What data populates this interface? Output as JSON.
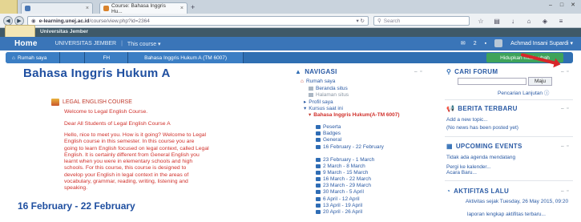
{
  "browser": {
    "tabs": [
      {
        "label": ""
      },
      {
        "label": "Course: Bahasa Inggris Hu..."
      }
    ],
    "new_tab": "+",
    "url_host": "e-learning.unej.ac.id",
    "url_path": "/course/view.php?id=2364",
    "search_placeholder": "Search"
  },
  "site": {
    "name": "Universitas Jember",
    "menu": {
      "home": "Home",
      "items": [
        "UNIVERSITAS JEMBER",
        "This course ▾"
      ],
      "user": "Achmad Insani Supardi ▾",
      "count": "2"
    }
  },
  "breadcrumb": [
    "Rumah saya",
    "",
    "FH",
    "Bahasa Inggris Hukum A (TM 6007)"
  ],
  "edit_button": "Hidupkan mode ubah",
  "course": {
    "title": "Bahasa Inggris Hukum A",
    "section_label": "LEGAL ENGLISH COURSE",
    "welcome": "Welcome to Legal English Course.",
    "greeting": "Dear All Students of Legal English Course A",
    "body": [
      "Hello, nice to meet you. How is it going? Welcome to Legal",
      "English course in this semester. In this course you are",
      "going to learn English focused on legal context, called Legal",
      "English. It is certainly different from General English you",
      "learnt when you were in elementary schools and high",
      "schools. For this course, this course is designed to",
      "develop your English in legal context in the areas of",
      "vocabulary, grammar, reading, writing, listening and",
      "speaking."
    ],
    "week_title": "16 February - 22 February"
  },
  "navigation": {
    "title": "NAVIGASI",
    "controls": "– ▫",
    "home": "Rumah saya",
    "items": [
      "Beranda situs",
      "Halaman situs",
      "Profil saya",
      "Kursus saat ini"
    ],
    "current_course": "Bahasa Inggris Hukum(A-TM 6007)",
    "sub": [
      "Peserta",
      "Badges",
      "General",
      "16 February - 22 February",
      "23 February - 1 March",
      "2 March - 8 March",
      "9 March - 15 March",
      "16 March - 22 March",
      "23 March - 29 March",
      "30 March - 5 April",
      "6 April - 12 April",
      "13 April - 19 April",
      "20 April - 26 April"
    ]
  },
  "forum_search": {
    "title": "CARI FORUM",
    "controls": "– ▫",
    "button": "Maju",
    "advanced": "Pencarian Lanjutan"
  },
  "news": {
    "title": "BERITA TERBARU",
    "add": "Add a new topic...",
    "empty": "(No news has been posted yet)"
  },
  "events": {
    "title": "UPCOMING EVENTS",
    "empty": "Tidak ada agenda mendatang",
    "goto": "Pergi ke kalender...",
    "new": "Acara Baru..."
  },
  "activity": {
    "title": "AKTIFITAS LALU",
    "since": "Aktivitas sejak Tuesday, 26 May 2015, 09:20",
    "full": "laporan lengkap aktifitas terbaru..."
  },
  "colors": {
    "accent": "#3a75b8",
    "title": "#1f4fa0",
    "text_red": "#d0302b",
    "edit_green": "#3ea35a"
  }
}
